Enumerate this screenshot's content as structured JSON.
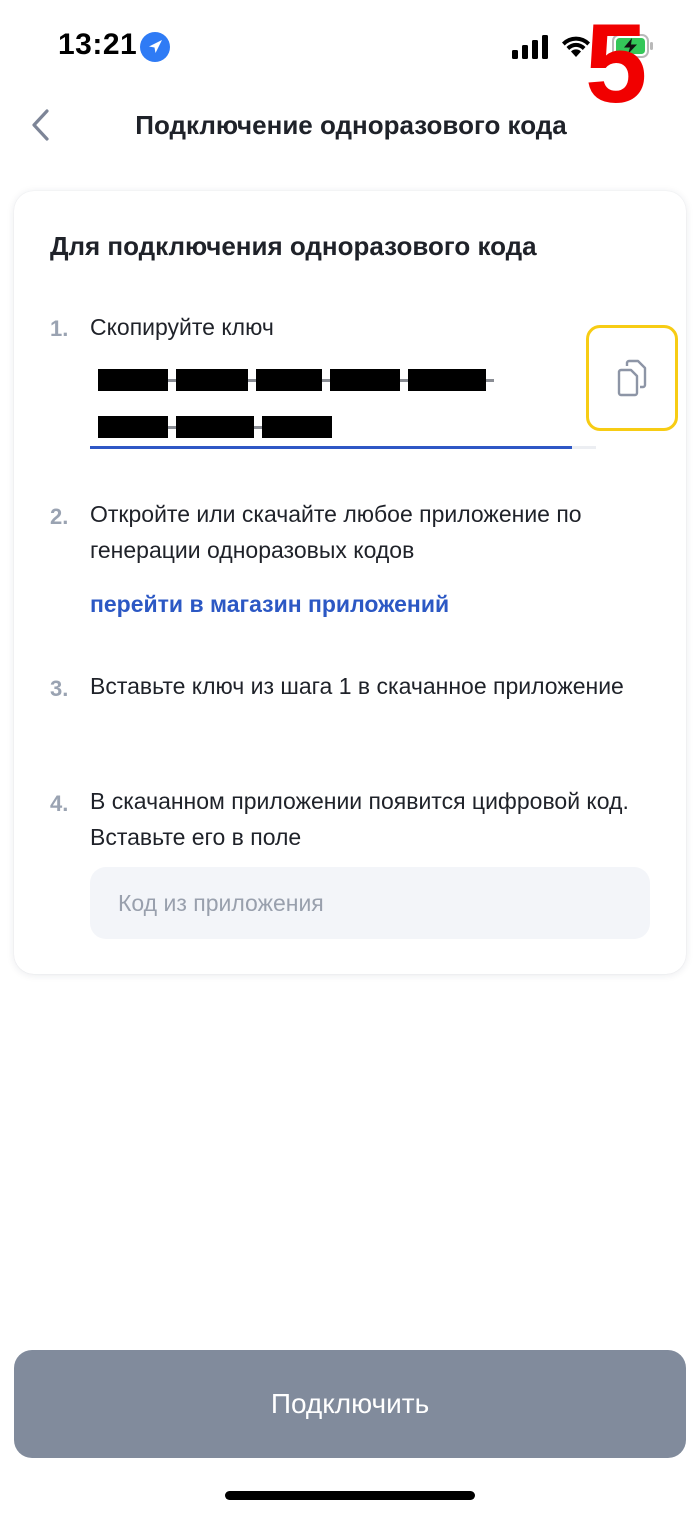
{
  "status_bar": {
    "time": "13:21",
    "overlay_number": "5",
    "icons": [
      "location-arrow-icon",
      "signal-icon",
      "wifi-icon",
      "battery-charging-icon"
    ],
    "colors": {
      "location": "#2f7bf5",
      "battery": "#34c759",
      "overlay": "#f10000"
    }
  },
  "nav": {
    "back_icon": "chevron-left-icon",
    "title": "Подключение одноразового кода"
  },
  "card": {
    "title": "Для подключения одноразового кода",
    "steps": [
      {
        "num": "1.",
        "text": "Скопируйте ключ"
      },
      {
        "num": "2.",
        "text": "Откройте или скачайте любое приложение по генерации одноразовых кодов"
      },
      {
        "num": "3.",
        "text": "Вставьте ключ из шага 1 в скачанное приложение"
      },
      {
        "num": "4.",
        "text": "В скачанном приложении появится цифровой код. Вставьте его в поле"
      }
    ],
    "key": {
      "redacted": true,
      "copy_icon": "copy-icon"
    },
    "store_link": "перейти в магазин приложений",
    "code_input": {
      "placeholder": "Код из приложения",
      "value": ""
    }
  },
  "footer": {
    "connect_label": "Подключить"
  },
  "colors": {
    "accent": "#2c58c4",
    "highlight": "#f7cc14",
    "button_disabled": "#818b9c",
    "step_number": "#9aa3b2"
  }
}
